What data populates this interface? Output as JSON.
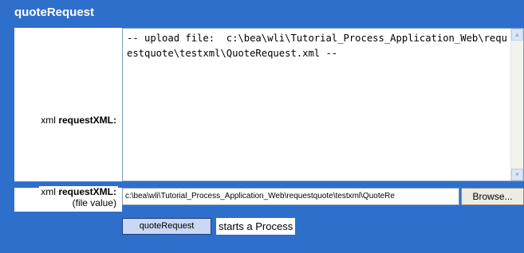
{
  "header": {
    "title": "quoteRequest"
  },
  "xml_field": {
    "prefix": "xml",
    "name": "requestXML:",
    "content": "-- upload file:  c:\\bea\\wli\\Tutorial_Process_Application_Web\\requestquote\\testxml\\QuoteRequest.xml --"
  },
  "file_field": {
    "prefix": "xml",
    "name": "requestXML:",
    "sub": "(file value)",
    "value": "c:\\bea\\wli\\Tutorial_Process_Application_Web\\requestquote\\testxml\\QuoteRe",
    "browse_label": "Browse..."
  },
  "action": {
    "button_label": "quoteRequest",
    "description": "starts a Process"
  },
  "icons": {
    "scroll_up": "scroll-up-arrow-icon",
    "scroll_down": "scroll-down-arrow-icon"
  },
  "colors": {
    "accent": "#2f6fcc",
    "button": "#c8d8f5"
  }
}
